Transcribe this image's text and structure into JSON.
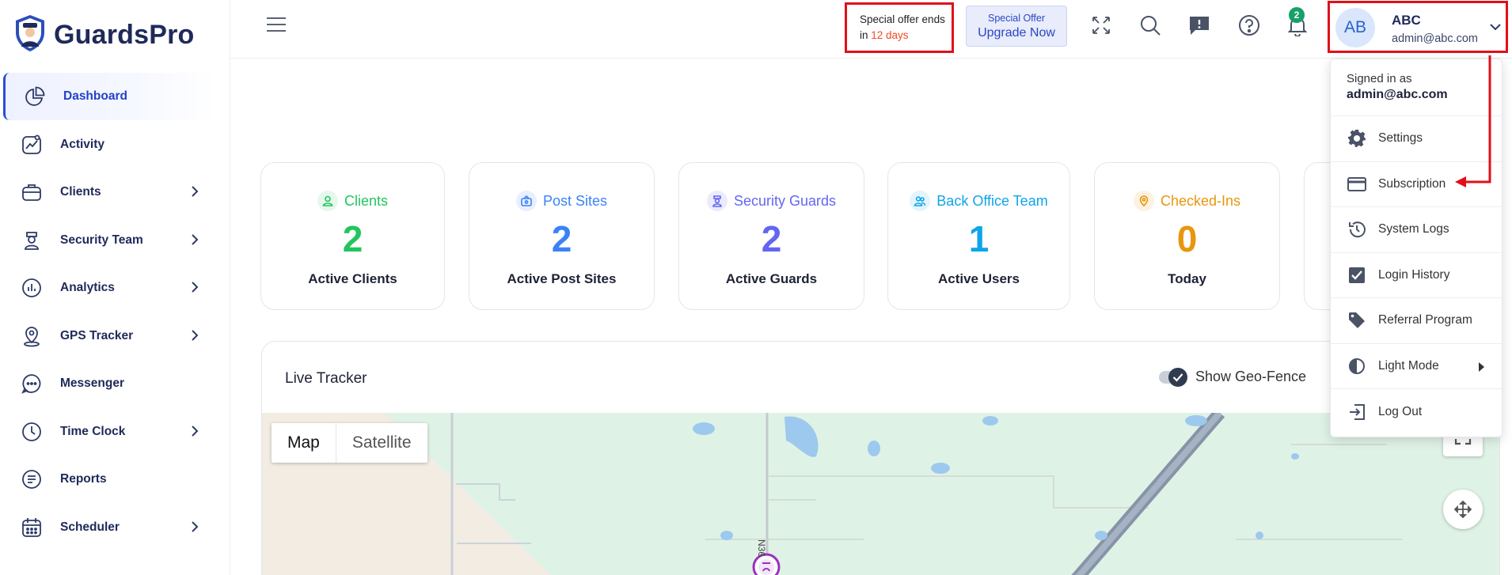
{
  "brand": {
    "name": "GuardsPro"
  },
  "sidebar": {
    "items": [
      {
        "label": "Dashboard",
        "icon": "pie-chart-icon",
        "active": true,
        "has_children": false
      },
      {
        "label": "Activity",
        "icon": "activity-chart-icon",
        "active": false,
        "has_children": false
      },
      {
        "label": "Clients",
        "icon": "briefcase-icon",
        "active": false,
        "has_children": true
      },
      {
        "label": "Security Team",
        "icon": "guard-icon",
        "active": false,
        "has_children": true
      },
      {
        "label": "Analytics",
        "icon": "bar-chart-icon",
        "active": false,
        "has_children": true
      },
      {
        "label": "GPS Tracker",
        "icon": "location-pin-icon",
        "active": false,
        "has_children": true
      },
      {
        "label": "Messenger",
        "icon": "chat-bubble-icon",
        "active": false,
        "has_children": false
      },
      {
        "label": "Time Clock",
        "icon": "clock-icon",
        "active": false,
        "has_children": true
      },
      {
        "label": "Reports",
        "icon": "document-icon",
        "active": false,
        "has_children": false
      },
      {
        "label": "Scheduler",
        "icon": "calendar-icon",
        "active": false,
        "has_children": true
      }
    ]
  },
  "topbar": {
    "offer": {
      "line1": "Special offer ends",
      "prefix": "in ",
      "days": "12 days"
    },
    "upgrade": {
      "small": "Special Offer",
      "label": "Upgrade Now"
    },
    "notification_count": "2",
    "user": {
      "initials": "AB",
      "name": "ABC",
      "email": "admin@abc.com"
    }
  },
  "stats": [
    {
      "title": "Clients",
      "value": "2",
      "subtitle": "Active Clients",
      "color": "#22c55e",
      "icon_bg": "#e6f8ec"
    },
    {
      "title": "Post Sites",
      "value": "2",
      "subtitle": "Active Post Sites",
      "color": "#3b82f6",
      "icon_bg": "#e8f0fe"
    },
    {
      "title": "Security Guards",
      "value": "2",
      "subtitle": "Active Guards",
      "color": "#6366f1",
      "icon_bg": "#ecebfd"
    },
    {
      "title": "Back Office Team",
      "value": "1",
      "subtitle": "Active Users",
      "color": "#0ea5e9",
      "icon_bg": "#e4f4fd"
    },
    {
      "title": "Checked-Ins",
      "value": "0",
      "subtitle": "Today",
      "color": "#e8960c",
      "icon_bg": "#fdf2e2"
    }
  ],
  "tracker": {
    "title": "Live Tracker",
    "geofence_label": "Show Geo-Fence",
    "geofence_on": true,
    "map_type_map": "Map",
    "map_type_satellite": "Satellite",
    "road_label": "N36"
  },
  "dropdown": {
    "signed_in_label": "Signed in as",
    "signed_in_email": "admin@abc.com",
    "items": [
      {
        "label": "Settings",
        "icon": "gear-icon"
      },
      {
        "label": "Subscription",
        "icon": "credit-card-icon"
      },
      {
        "label": "System Logs",
        "icon": "history-icon"
      },
      {
        "label": "Login History",
        "icon": "checkbox-icon"
      },
      {
        "label": "Referral Program",
        "icon": "tag-icon"
      },
      {
        "label": "Light Mode",
        "icon": "contrast-icon",
        "submenu": true
      },
      {
        "label": "Log Out",
        "icon": "logout-icon"
      }
    ]
  },
  "colors": {
    "accent": "#2340c8",
    "annotation_red": "#e0101a",
    "navy": "#1e2a5a"
  }
}
